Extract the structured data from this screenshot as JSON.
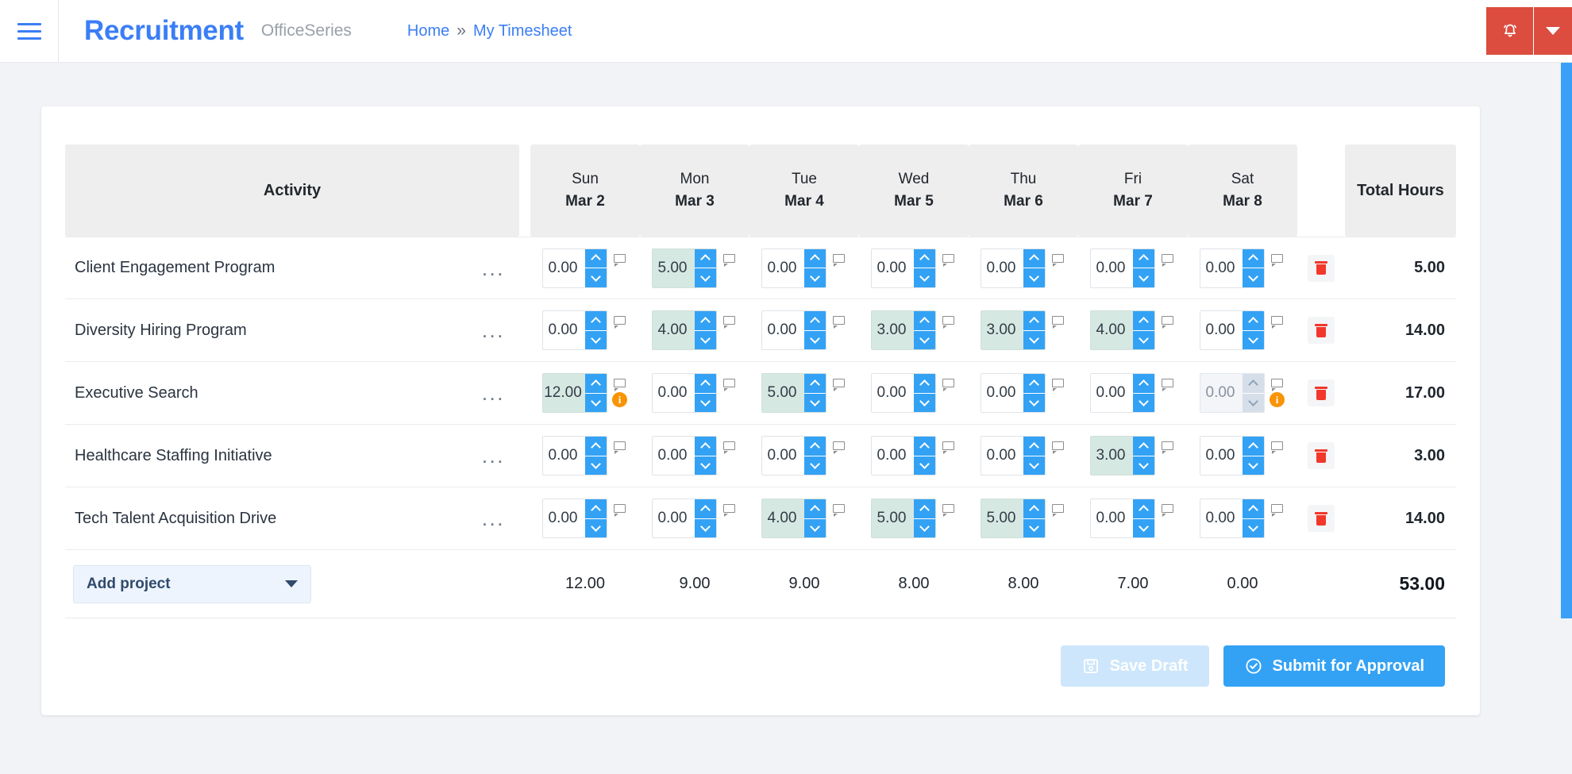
{
  "navbar": {
    "menu_icon": "hamburger-icon",
    "brand_title": "Recruitment",
    "brand_subtitle": "OfficeSeries",
    "breadcrumb": {
      "home": "Home",
      "separator": "»",
      "current": "My Timesheet"
    },
    "bell_icon": "bell-icon",
    "caret_icon": "chevron-down-icon",
    "accent_red": "#dc4c3f",
    "accent_blue": "#3b7ef5"
  },
  "table": {
    "headers": {
      "activity": "Activity",
      "total": "Total Hours",
      "days": [
        {
          "dow": "Sun",
          "date": "Mar 2"
        },
        {
          "dow": "Mon",
          "date": "Mar 3"
        },
        {
          "dow": "Tue",
          "date": "Mar 4"
        },
        {
          "dow": "Wed",
          "date": "Mar 5"
        },
        {
          "dow": "Thu",
          "date": "Mar 6"
        },
        {
          "dow": "Fri",
          "date": "Mar 7"
        },
        {
          "dow": "Sat",
          "date": "Mar 8"
        }
      ]
    },
    "rows": [
      {
        "name": "Client Engagement Program",
        "menu": "...",
        "total": "5.00",
        "cells": [
          {
            "value": "0.00",
            "filled": false,
            "disabled": false,
            "warning": false
          },
          {
            "value": "5.00",
            "filled": true,
            "disabled": false,
            "warning": false
          },
          {
            "value": "0.00",
            "filled": false,
            "disabled": false,
            "warning": false
          },
          {
            "value": "0.00",
            "filled": false,
            "disabled": false,
            "warning": false
          },
          {
            "value": "0.00",
            "filled": false,
            "disabled": false,
            "warning": false
          },
          {
            "value": "0.00",
            "filled": false,
            "disabled": false,
            "warning": false
          },
          {
            "value": "0.00",
            "filled": false,
            "disabled": false,
            "warning": false
          }
        ]
      },
      {
        "name": "Diversity Hiring Program",
        "menu": "...",
        "total": "14.00",
        "cells": [
          {
            "value": "0.00",
            "filled": false,
            "disabled": false,
            "warning": false
          },
          {
            "value": "4.00",
            "filled": true,
            "disabled": false,
            "warning": false
          },
          {
            "value": "0.00",
            "filled": false,
            "disabled": false,
            "warning": false
          },
          {
            "value": "3.00",
            "filled": true,
            "disabled": false,
            "warning": false
          },
          {
            "value": "3.00",
            "filled": true,
            "disabled": false,
            "warning": false
          },
          {
            "value": "4.00",
            "filled": true,
            "disabled": false,
            "warning": false
          },
          {
            "value": "0.00",
            "filled": false,
            "disabled": false,
            "warning": false
          }
        ]
      },
      {
        "name": "Executive Search",
        "menu": "...",
        "total": "17.00",
        "cells": [
          {
            "value": "12.00",
            "filled": true,
            "disabled": false,
            "warning": true
          },
          {
            "value": "0.00",
            "filled": false,
            "disabled": false,
            "warning": false
          },
          {
            "value": "5.00",
            "filled": true,
            "disabled": false,
            "warning": false
          },
          {
            "value": "0.00",
            "filled": false,
            "disabled": false,
            "warning": false
          },
          {
            "value": "0.00",
            "filled": false,
            "disabled": false,
            "warning": false
          },
          {
            "value": "0.00",
            "filled": false,
            "disabled": false,
            "warning": false
          },
          {
            "value": "0.00",
            "filled": false,
            "disabled": true,
            "warning": true
          }
        ]
      },
      {
        "name": "Healthcare Staffing Initiative",
        "menu": "...",
        "total": "3.00",
        "cells": [
          {
            "value": "0.00",
            "filled": false,
            "disabled": false,
            "warning": false
          },
          {
            "value": "0.00",
            "filled": false,
            "disabled": false,
            "warning": false
          },
          {
            "value": "0.00",
            "filled": false,
            "disabled": false,
            "warning": false
          },
          {
            "value": "0.00",
            "filled": false,
            "disabled": false,
            "warning": false
          },
          {
            "value": "0.00",
            "filled": false,
            "disabled": false,
            "warning": false
          },
          {
            "value": "3.00",
            "filled": true,
            "disabled": false,
            "warning": false
          },
          {
            "value": "0.00",
            "filled": false,
            "disabled": false,
            "warning": false
          }
        ]
      },
      {
        "name": "Tech Talent Acquisition Drive",
        "menu": "...",
        "total": "14.00",
        "cells": [
          {
            "value": "0.00",
            "filled": false,
            "disabled": false,
            "warning": false
          },
          {
            "value": "0.00",
            "filled": false,
            "disabled": false,
            "warning": false
          },
          {
            "value": "4.00",
            "filled": true,
            "disabled": false,
            "warning": false
          },
          {
            "value": "5.00",
            "filled": true,
            "disabled": false,
            "warning": false
          },
          {
            "value": "5.00",
            "filled": true,
            "disabled": false,
            "warning": false
          },
          {
            "value": "0.00",
            "filled": false,
            "disabled": false,
            "warning": false
          },
          {
            "value": "0.00",
            "filled": false,
            "disabled": false,
            "warning": false
          }
        ]
      }
    ],
    "footer": {
      "add_project_label": "Add project",
      "day_totals": [
        "12.00",
        "9.00",
        "9.00",
        "8.00",
        "8.00",
        "7.00",
        "0.00"
      ],
      "grand_total": "53.00"
    }
  },
  "actions": {
    "save_draft_label": "Save Draft",
    "save_draft_icon": "floppy-disk-icon",
    "submit_label": "Submit for Approval",
    "submit_icon": "check-circle-icon"
  },
  "colors": {
    "filled_cell": "#d6e8e2",
    "spinner_blue": "#33a2f5",
    "warning_orange": "#f89406",
    "trash_red": "#f1382b"
  }
}
